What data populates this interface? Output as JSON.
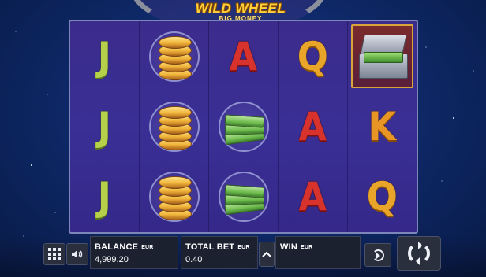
{
  "game": {
    "logo_main": "WILD WHEEL",
    "logo_sub": "BIG MONEY"
  },
  "reels": [
    [
      "J",
      "J",
      "J"
    ],
    [
      "coins",
      "coins",
      "coins"
    ],
    [
      "A",
      "money",
      "money"
    ],
    [
      "Q",
      "A",
      "A"
    ],
    [
      "money-case",
      "K",
      "Q"
    ]
  ],
  "bottom_bar": {
    "balance_label": "BALANCE",
    "balance_currency": "EUR",
    "balance_value": "4,999.20",
    "total_bet_label": "TOTAL BET",
    "total_bet_currency": "EUR",
    "total_bet_value": "0.40",
    "win_label": "WIN",
    "win_currency": "EUR",
    "win_value": ""
  },
  "icons": {
    "menu": "grid-menu-icon",
    "sound": "speaker-icon",
    "bet_adjust": "chevron-up-icon",
    "autoplay": "autoplay-icon",
    "spin": "spin-arrows-icon"
  },
  "colors": {
    "J": "#b6d04a",
    "A": "#d8322c",
    "Q": "#e9a52a",
    "K": "#e79524",
    "logo": "#ffd23c"
  }
}
